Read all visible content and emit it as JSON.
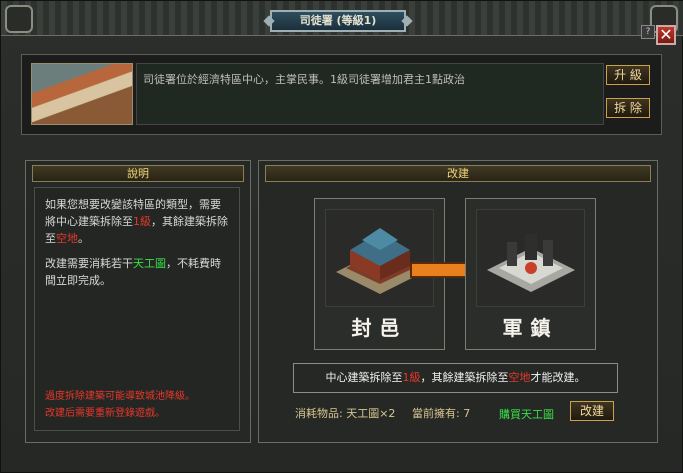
{
  "window": {
    "title": "司徒署 (等級1)",
    "help": "?",
    "close": "✕"
  },
  "info": {
    "description": "司徒署位於經濟特區中心，主掌民事。1級司徒署增加君主1點政治",
    "upgrade_label": "升 級",
    "demolish_label": "拆 除"
  },
  "explain": {
    "header": "說明",
    "line1_pre": "如果您想要改變該特區的類型，需要將中心建築拆除至",
    "line1_level": "1級",
    "line1_mid": "，其餘建築拆除至",
    "line1_empty": "空地",
    "line1_end": "。",
    "line2_pre": "改建需要消耗若干",
    "line2_item": "天工圖",
    "line2_end": "，不耗費時間立即完成。",
    "warn1": "過度拆除建築可能導致城池降級。",
    "warn2": "改建后需要重新登錄遊戲。"
  },
  "rebuild": {
    "header": "改建",
    "from_label": "封邑",
    "to_label": "軍鎮",
    "rule_pre": "中心建築拆除至",
    "rule_level": "1級",
    "rule_mid": "，其餘建築拆除至",
    "rule_empty": "空地",
    "rule_end": "才能改建。",
    "cost_label": "消耗物品: 天工圖×2",
    "owned_label": "當前擁有: 7",
    "buy_link": "購買天工圖",
    "rebuild_button": "改建"
  },
  "colors": {
    "highlight_red": "#e8372a",
    "highlight_green": "#38e048",
    "arrow_orange": "#e8801e"
  }
}
